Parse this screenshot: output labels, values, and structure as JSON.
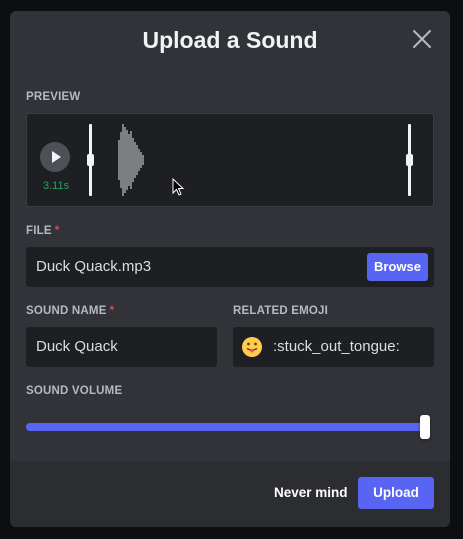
{
  "modal": {
    "title": "Upload a Sound"
  },
  "preview": {
    "label": "PREVIEW",
    "duration": "3.11s"
  },
  "file": {
    "label": "FILE",
    "required_mark": "*",
    "value": "Duck Quack.mp3",
    "browse_label": "Browse"
  },
  "sound_name": {
    "label": "SOUND NAME",
    "required_mark": "*",
    "value": "Duck Quack"
  },
  "related_emoji": {
    "label": "RELATED EMOJI",
    "value": ":stuck_out_tongue:",
    "icon": "stuck-out-tongue-emoji"
  },
  "sound_volume": {
    "label": "SOUND VOLUME",
    "value_fraction": 1.0
  },
  "footer": {
    "cancel_label": "Never mind",
    "submit_label": "Upload"
  },
  "colors": {
    "accent": "#5865f2",
    "duration_green": "#23a55a",
    "required_red": "#f23f43",
    "modal_bg": "#313338",
    "field_bg": "#1e1f22"
  }
}
